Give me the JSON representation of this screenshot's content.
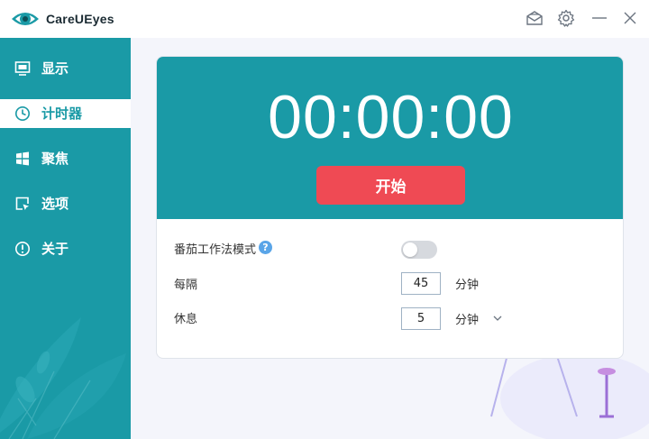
{
  "app": {
    "title": "CareUEyes"
  },
  "sidebar": {
    "items": [
      {
        "label": "显示",
        "icon": "monitor-icon"
      },
      {
        "label": "计时器",
        "icon": "clock-icon",
        "active": true
      },
      {
        "label": "聚焦",
        "icon": "windows-icon"
      },
      {
        "label": "选项",
        "icon": "cursor-icon"
      },
      {
        "label": "关于",
        "icon": "info-icon"
      }
    ]
  },
  "timer": {
    "display": "00:00:00",
    "start_label": "开始"
  },
  "settings": {
    "pomodoro_label": "番茄工作法模式",
    "pomodoro_help": "?",
    "pomodoro_enabled": false,
    "interval_label": "每隔",
    "interval_value": "45",
    "interval_unit": "分钟",
    "rest_label": "休息",
    "rest_value": "5",
    "rest_unit": "分钟"
  },
  "colors": {
    "accent": "#1a9aa6",
    "start_button": "#ef4a54",
    "help": "#5aa5e8"
  }
}
